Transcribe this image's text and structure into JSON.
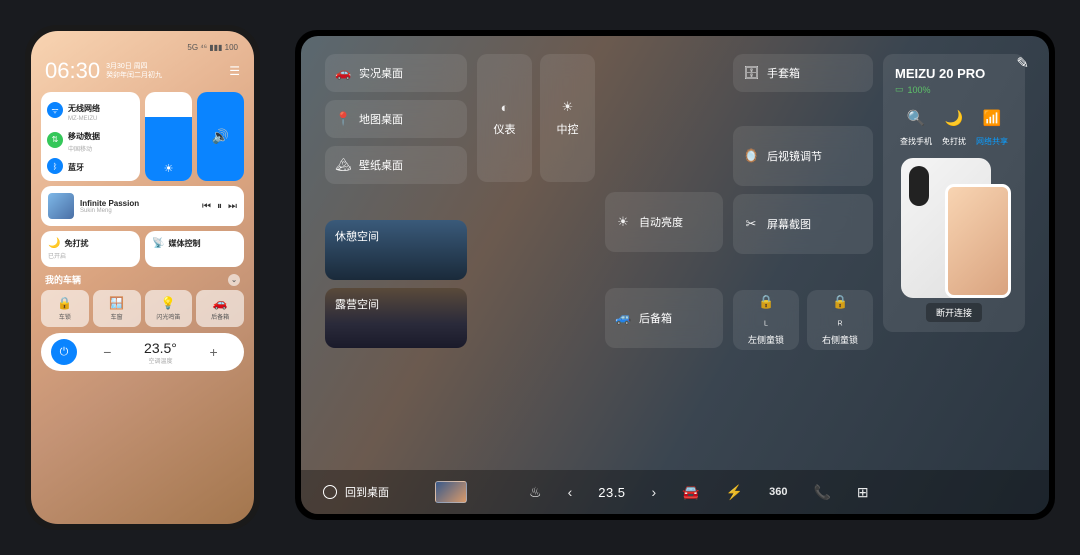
{
  "phone": {
    "status": "5G ⁴⁶ ▮▮▮ 100",
    "time": "06:30",
    "date_line1": "3月30日 周四",
    "date_line2": "癸卯年闰二月初九",
    "toggles": {
      "wifi": {
        "label": "无线网络",
        "sub": "MZ-MEIZU"
      },
      "data": {
        "label": "移动数据",
        "sub": "中国移动"
      },
      "bt": {
        "label": "蓝牙",
        "sub": ""
      }
    },
    "music": {
      "title": "Infinite Passion",
      "artist": "Sukin Meng"
    },
    "dnd": {
      "label": "免打扰",
      "sub": "已开启"
    },
    "media": {
      "label": "媒体控制",
      "sub": ""
    },
    "car_section": {
      "title": "我的车辆",
      "items": [
        {
          "icon": "🔒",
          "label": "车锁"
        },
        {
          "icon": "🪟",
          "label": "车窗"
        },
        {
          "icon": "💡",
          "label": "闪光鸣笛"
        },
        {
          "icon": "🚗",
          "label": "后备箱"
        }
      ]
    },
    "climate": {
      "temp": "23.5°",
      "label": "空调温度"
    }
  },
  "tablet": {
    "col1": [
      {
        "icon": "🚗",
        "label": "实况桌面"
      },
      {
        "icon": "📍",
        "label": "地图桌面"
      },
      {
        "icon": "🏔",
        "label": "壁纸桌面"
      }
    ],
    "scenes": [
      {
        "label": "休憩空间"
      },
      {
        "label": "露营空间"
      }
    ],
    "col2": {
      "dash": "仪表",
      "center": "中控"
    },
    "col3": {
      "autobright": {
        "icon": "☀",
        "label": "自动亮度"
      },
      "trunk": {
        "icon": "🚙",
        "label": "后备箱"
      }
    },
    "col4": {
      "glove": {
        "icon": "🗄",
        "label": "手套箱"
      },
      "mirror": {
        "icon": "🪞",
        "label": "后视镜调节"
      },
      "screenshot": {
        "icon": "✂",
        "label": "屏幕截图"
      },
      "lockL": {
        "icon": "🔒",
        "sub": "L",
        "label": "左侧童锁"
      },
      "lockR": {
        "icon": "🔒",
        "sub": "R",
        "label": "右侧童锁"
      }
    },
    "device": {
      "name": "MEIZU 20 PRO",
      "battery": "100%",
      "actions": [
        {
          "icon": "🔍",
          "label": "查找手机"
        },
        {
          "icon": "🌙",
          "label": "免打扰"
        },
        {
          "icon": "📶",
          "label": "网络共享",
          "active": true
        }
      ],
      "disconnect": "断开连接"
    },
    "dock": {
      "home": "回到桌面",
      "temp": "23.5",
      "icons": {
        "defrost": "♨",
        "car": "🚘",
        "flash": "⚡",
        "cam": "360",
        "call": "📞",
        "apps": "⊞"
      }
    }
  }
}
